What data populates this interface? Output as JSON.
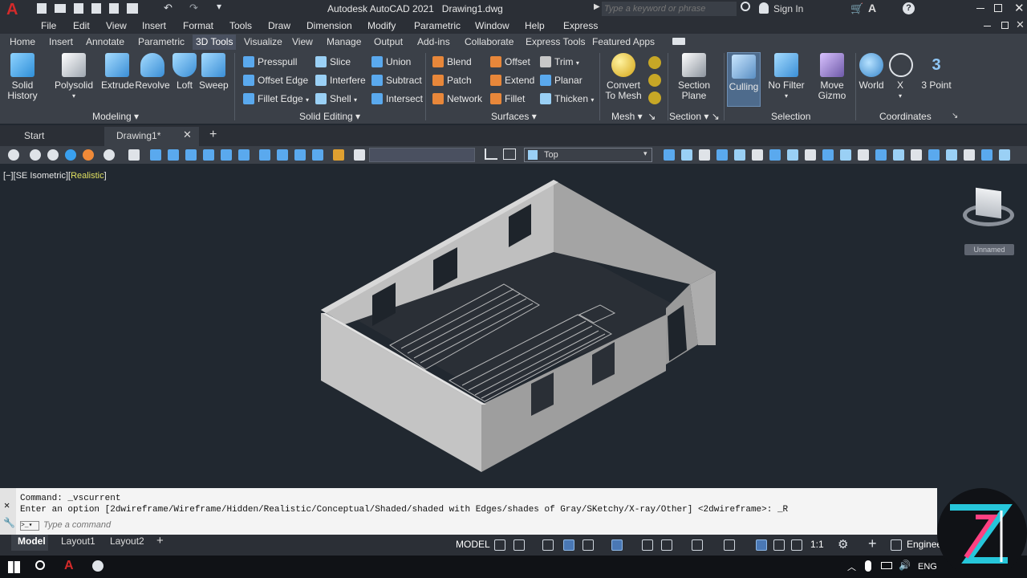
{
  "titlebar": {
    "app_title": "Autodesk AutoCAD 2021",
    "file_name": "Drawing1.dwg",
    "search_placeholder": "Type a keyword or phrase",
    "sign_in": "Sign In"
  },
  "menubar": [
    "File",
    "Edit",
    "View",
    "Insert",
    "Format",
    "Tools",
    "Draw",
    "Dimension",
    "Modify",
    "Parametric",
    "Window",
    "Help",
    "Express"
  ],
  "ribbon_tabs": [
    "Home",
    "Insert",
    "Annotate",
    "Parametric",
    "3D Tools",
    "Visualize",
    "View",
    "Manage",
    "Output",
    "Add-ins",
    "Collaborate",
    "Express Tools",
    "Featured Apps"
  ],
  "ribbon_active_tab": "3D Tools",
  "ribbon": {
    "solid_history": [
      "Solid",
      "History"
    ],
    "polysolid": "Polysolid",
    "extrude": "Extrude",
    "revolve": "Revolve",
    "loft": "Loft",
    "sweep": "Sweep",
    "modeling_label": "Modeling",
    "presspull": "Presspull",
    "offset_edge": "Offset Edge",
    "fillet_edge": "Fillet Edge",
    "slice": "Slice",
    "interfere": "Interfere",
    "shell": "Shell",
    "union": "Union",
    "subtract": "Subtract",
    "intersect": "Intersect",
    "solid_editing_label": "Solid Editing",
    "blend": "Blend",
    "patch": "Patch",
    "network": "Network",
    "offset": "Offset",
    "extend": "Extend",
    "fillet": "Fillet",
    "trim": "Trim",
    "planar": "Planar",
    "thicken": "Thicken",
    "surfaces_label": "Surfaces",
    "convert_to_mesh": [
      "Convert",
      "To Mesh"
    ],
    "mesh_label": "Mesh",
    "section_plane": [
      "Section",
      "Plane"
    ],
    "section_label": "Section",
    "culling": "Culling",
    "no_filter": "No Filter",
    "move_gizmo": [
      "Move",
      "Gizmo"
    ],
    "selection_label": "Selection",
    "world": "World",
    "x": "X",
    "three_point": "3 Point",
    "coordinates_label": "Coordinates"
  },
  "file_tabs": {
    "start": "Start",
    "drawing": "Drawing1*"
  },
  "toolbar": {
    "view_select": "Top"
  },
  "viewport": {
    "controls_prefix": "[−][SE Isometric][",
    "visual_style": "Realistic",
    "controls_suffix": "]",
    "viewcube_label": "Unnamed"
  },
  "command": {
    "line1": "Command: _vscurrent",
    "line2": "Enter an option [2dwireframe/Wireframe/Hidden/Realistic/Conceptual/Shaded/shaded with Edges/shades of Gray/SKetchy/X-ray/Other] <2dwireframe>: _R",
    "input_placeholder": "Type a command"
  },
  "status": {
    "model_tab": "Model",
    "layout1": "Layout1",
    "layout2": "Layout2",
    "model_space": "MODEL",
    "scale": "1:1",
    "units": "Engineer"
  },
  "taskbar": {
    "lang": "ENG"
  },
  "colors": {
    "accent": "#c0392b",
    "viewport_bg": "#212830",
    "wall": "#b9b9b9",
    "visual_style": "#e0e060"
  }
}
